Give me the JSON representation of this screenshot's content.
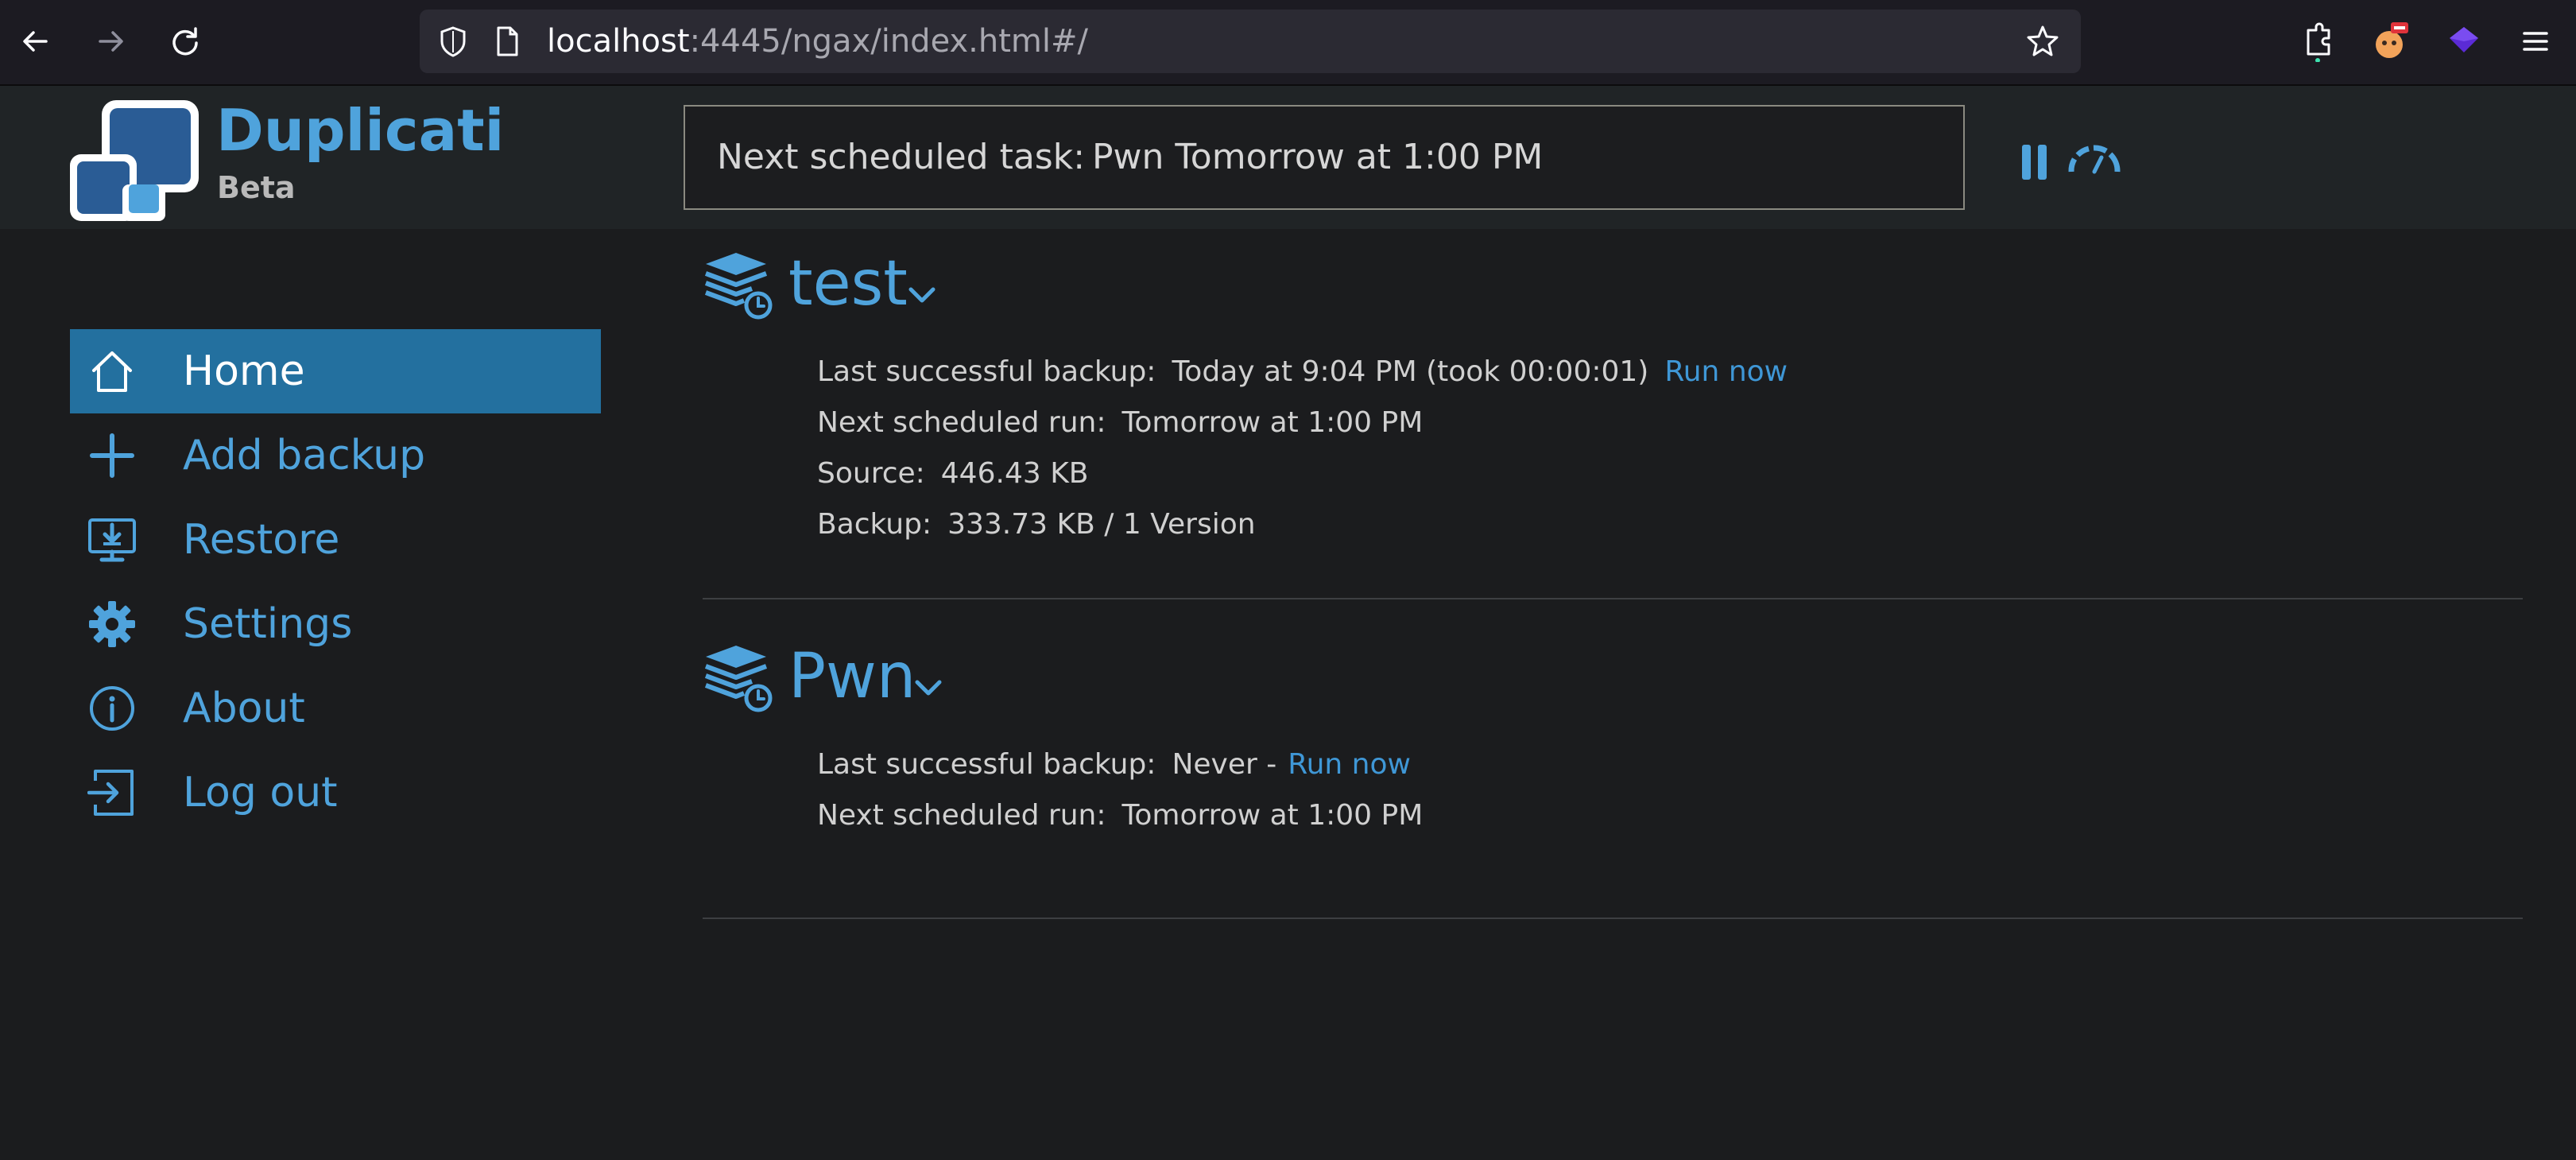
{
  "browser": {
    "url_host": "localhost",
    "url_rest": ":4445/ngax/index.html#/"
  },
  "app": {
    "brand_name": "Duplicati",
    "brand_tag": "Beta",
    "status_label": "Next scheduled task:",
    "status_value": "Pwn Tomorrow at 1:00 PM"
  },
  "sidebar": {
    "items": [
      {
        "label": "Home",
        "icon": "home-icon"
      },
      {
        "label": "Add backup",
        "icon": "plus-icon"
      },
      {
        "label": "Restore",
        "icon": "restore-icon"
      },
      {
        "label": "Settings",
        "icon": "gear-icon"
      },
      {
        "label": "About",
        "icon": "info-icon"
      },
      {
        "label": "Log out",
        "icon": "logout-icon"
      }
    ]
  },
  "backups": [
    {
      "name": "test",
      "last_label": "Last successful backup:",
      "last_value": "Today at 9:04 PM (took 00:00:01)",
      "run_now": "Run now",
      "next_label": "Next scheduled run:",
      "next_value": "Tomorrow at 1:00 PM",
      "source_label": "Source:",
      "source_value": "446.43 KB",
      "backup_label": "Backup:",
      "backup_value": "333.73 KB / 1 Version"
    },
    {
      "name": "Pwn",
      "last_label": "Last successful backup:",
      "last_value": "Never -",
      "run_now": "Run now",
      "next_label": "Next scheduled run:",
      "next_value": "Tomorrow at 1:00 PM"
    }
  ],
  "colors": {
    "accent": "#4fa3dc",
    "active_bg": "#23709f",
    "page_bg": "#1b1c1e"
  }
}
